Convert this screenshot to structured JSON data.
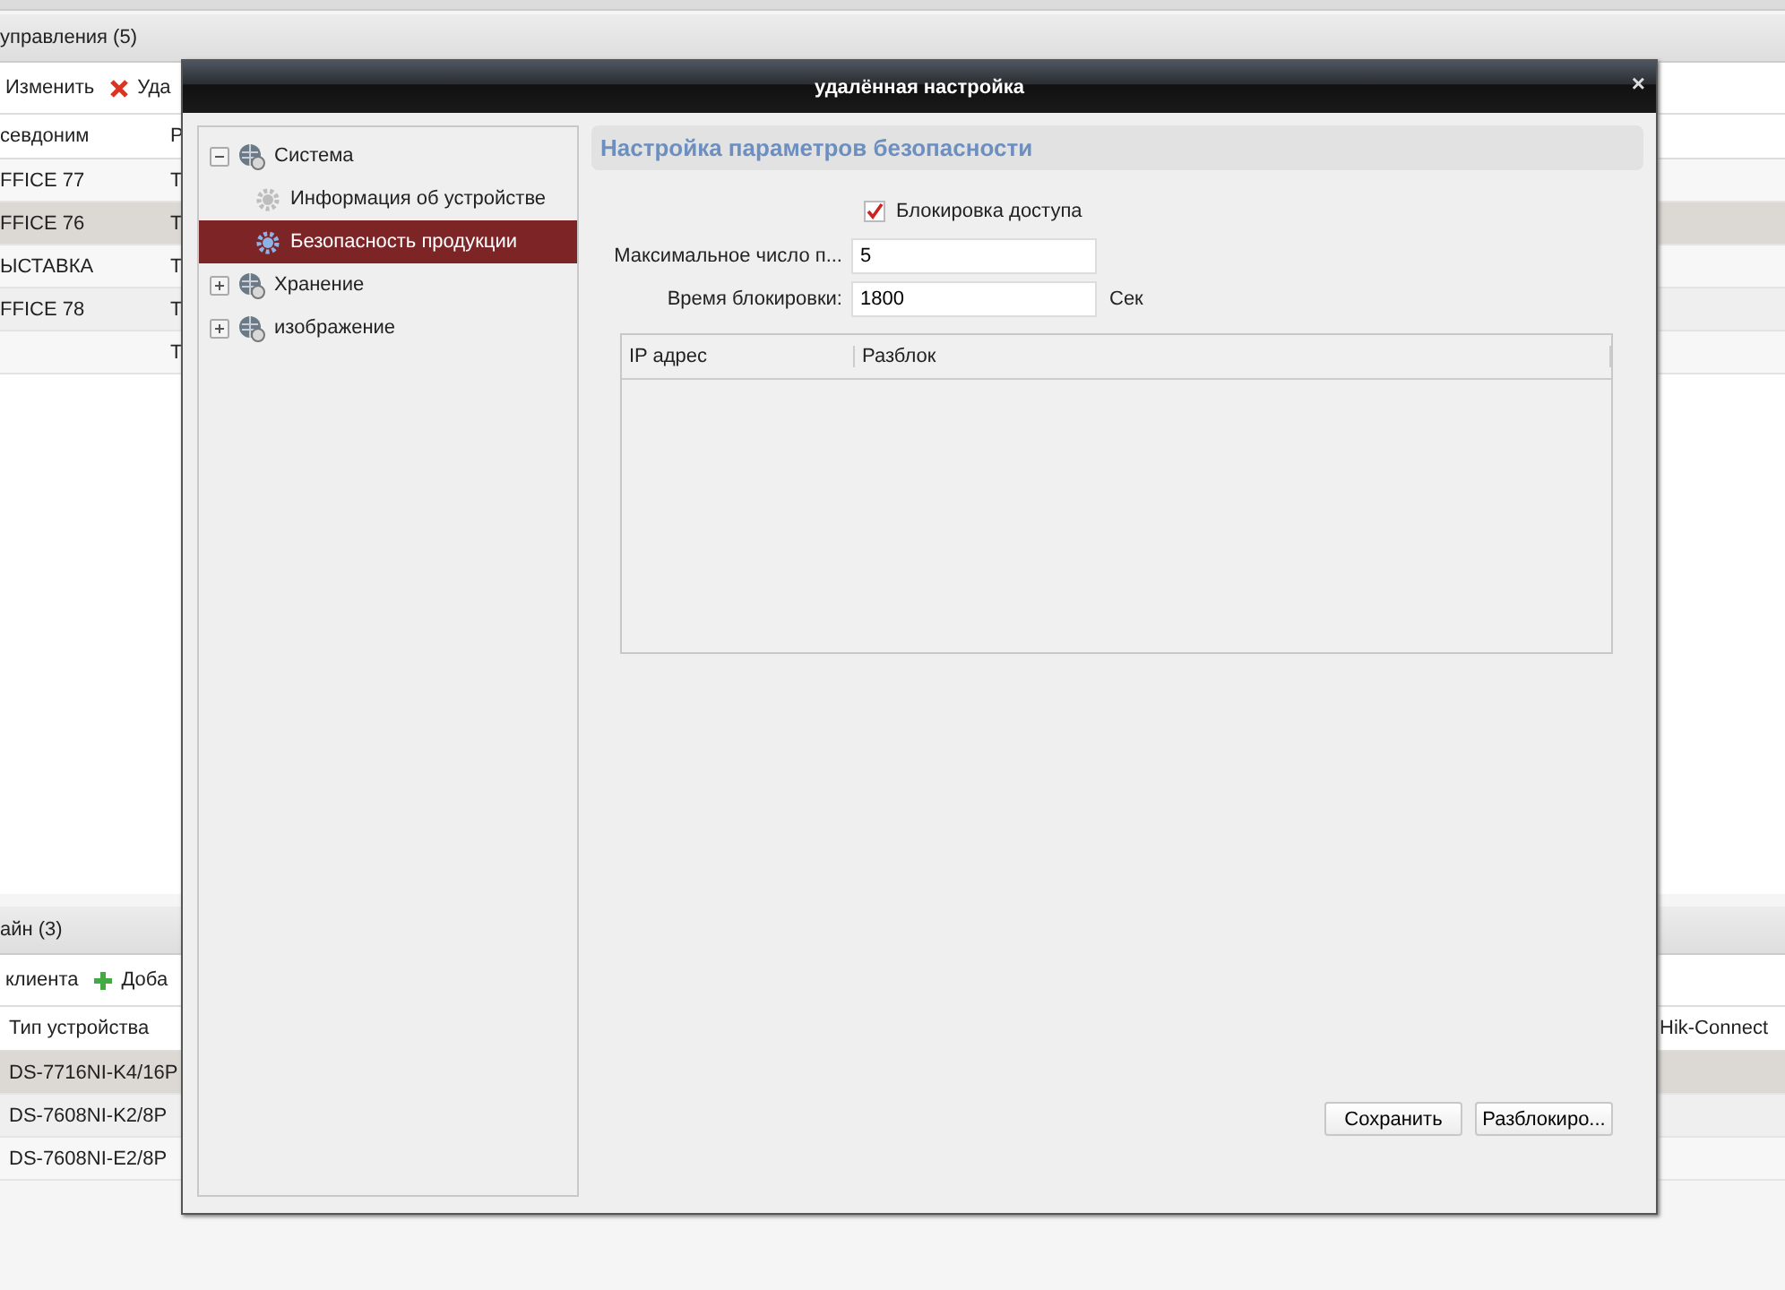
{
  "background": {
    "sections": [
      {
        "title": "управления (5)",
        "toolbar": [
          {
            "kind": "plain",
            "label": "Изменить"
          },
          {
            "kind": "delete",
            "label": "Уда"
          }
        ],
        "columns": [
          "севдоним",
          "Р"
        ],
        "rows": [
          {
            "cells": [
              "FFICE 77",
              "Т"
            ],
            "selected": false
          },
          {
            "cells": [
              "FFICE 76",
              "Т"
            ],
            "selected": true
          },
          {
            "cells": [
              "ЫСТАВКА",
              "Т"
            ],
            "selected": false
          },
          {
            "cells": [
              "FFICE 78",
              "Т"
            ],
            "selected": false
          },
          {
            "cells": [
              null,
              "Т"
            ],
            "selected": false
          }
        ]
      },
      {
        "title": "айн (3)",
        "toolbar": [
          {
            "kind": "plain",
            "label": "клиента"
          },
          {
            "kind": "add",
            "label": "Доба"
          }
        ],
        "columns": [
          "Тип устройства",
          "Hik-Connect"
        ],
        "rows": [
          {
            "cells": [
              "DS-7716NI-K4/16P",
              null
            ],
            "selected": true
          },
          {
            "cells": [
              "DS-7608NI-K2/8P",
              null
            ],
            "selected": false
          },
          {
            "cells": [
              "DS-7608NI-E2/8P",
              null
            ],
            "selected": false
          }
        ]
      }
    ]
  },
  "dialog": {
    "title": "удалённая настройка",
    "close": "×",
    "tree": [
      {
        "label": "Система",
        "expanded": true,
        "selected": false,
        "children": [
          {
            "label": "Информация об устройстве",
            "selected": false
          },
          {
            "label": "Безопасность продукции",
            "selected": true
          }
        ]
      },
      {
        "label": "Хранение",
        "expanded": false,
        "selected": false
      },
      {
        "label": "изображение",
        "expanded": false,
        "selected": false
      }
    ],
    "panel": {
      "title": "Настройка параметров безопасности",
      "lock_checkbox": {
        "label": "Блокировка доступа",
        "checked": true
      },
      "fields": [
        {
          "label": "Максимальное число п...",
          "value": "5"
        },
        {
          "label": "Время блокировки:",
          "value": "1800",
          "unit": "Сек"
        }
      ],
      "table": {
        "columns": [
          "IP адрес",
          "Разблок"
        ]
      },
      "buttons": [
        "Сохранить",
        "Разблокиро..."
      ]
    }
  }
}
